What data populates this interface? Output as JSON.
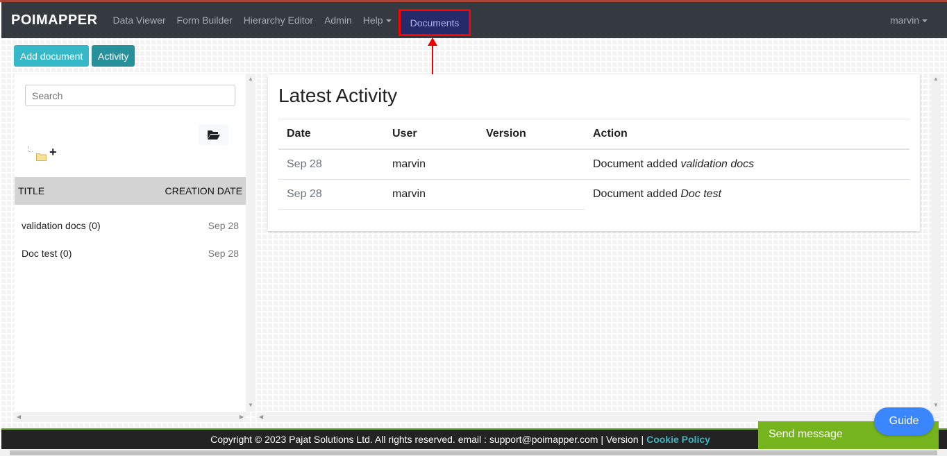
{
  "nav": {
    "logo": "POIMAPPER",
    "items": [
      "Data Viewer",
      "Form Builder",
      "Hierarchy Editor",
      "Admin",
      "Help"
    ],
    "active": "Documents",
    "user": "marvin"
  },
  "toolbar": {
    "add": "Add document",
    "activity": "Activity"
  },
  "colors": {
    "add": "#35b8c7",
    "activity": "#26919a",
    "nav": "#343a40",
    "highlight": "#ff0000"
  },
  "sidebar": {
    "search_placeholder": "Search",
    "col_title": "TITLE",
    "col_date": "CREATION DATE",
    "rows": [
      {
        "title": "validation docs (0)",
        "date": "Sep 28"
      },
      {
        "title": "Doc test (0)",
        "date": "Sep 28"
      }
    ]
  },
  "activity": {
    "title": "Latest Activity",
    "headers": [
      "Date",
      "User",
      "Version",
      "Action"
    ],
    "rows": [
      {
        "date": "Sep 28",
        "user": "marvin",
        "version": "",
        "action": "Document added ",
        "item": "validation docs"
      },
      {
        "date": "Sep 28",
        "user": "marvin",
        "version": "",
        "action": "Document added ",
        "item": "Doc test"
      }
    ]
  },
  "footer": {
    "text": "Copyright © 2023 Pajat Solutions Ltd. All rights reserved. email : support@poimapper.com | Version |",
    "cookie": "Cookie Policy"
  },
  "chat": {
    "send": "Send message",
    "guide": "Guide"
  }
}
